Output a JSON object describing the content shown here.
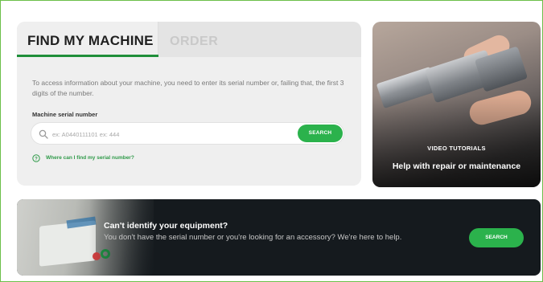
{
  "finder": {
    "tabs": [
      {
        "label": "FIND MY MACHINE",
        "active": true
      },
      {
        "label": "ORDER",
        "active": false
      }
    ],
    "intro_text": "To access information about your machine, you need to enter its serial number or, failing that, the first 3 digits of the number.",
    "field_label": "Machine serial number",
    "search": {
      "placeholder": "ex: A0440111101 ex: 444",
      "value": "",
      "button_label": "SEARCH",
      "icon": "search-icon"
    },
    "help_link": {
      "icon": "question-circle-icon",
      "label": "Where can I find my serial number?"
    }
  },
  "video_card": {
    "title": "VIDEO TUTORIALS",
    "subtitle": "Help with repair or maintenance"
  },
  "banner": {
    "title": "Can't identify your equipment?",
    "text": "You don't have the serial number or you're looking for an accessory? We're here to help.",
    "button_label": "SEARCH"
  },
  "colors": {
    "accent_green": "#2bb24c",
    "tab_underline": "#1f8f3a",
    "link_green": "#2f9a49",
    "frame_green": "#6cbf4a",
    "banner_bg": "#151a1e"
  }
}
